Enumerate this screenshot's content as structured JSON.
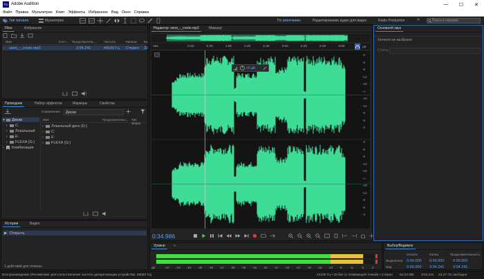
{
  "window": {
    "app_badge": "Au",
    "title": "Adobe Audition",
    "minimize": "—",
    "maximize": "☐",
    "close": "✕"
  },
  "menu": [
    "Файл",
    "Правка",
    "Мультитрек",
    "Клип",
    "Эффекты",
    "Избранное",
    "Вид",
    "Окно",
    "Справка"
  ],
  "toolbar": {
    "waveform_label": "Тип сигнала",
    "multitrack_label": "Мультитрек",
    "workspaces": [
      "По умолчанию",
      "Редактирование аудио для видео",
      "Radio Production"
    ],
    "more": "»",
    "search_placeholder": "Поиск в справке"
  },
  "files_panel": {
    "tabs": [
      "Files",
      "Избранное"
    ],
    "columns": [
      "Имя",
      "Сост...",
      "Продолжитель...",
      "Частота",
      "Каналы",
      "Би"
    ],
    "rows": [
      {
        "name": "sient_-_credo.mp3",
        "duration": "3:04.241",
        "rate": "44100 Гц",
        "channels": "Стерео",
        "bits": "32"
      }
    ]
  },
  "browser_panel": {
    "tabs": [
      "Проводник",
      "Набор эффектов",
      "Маркеры",
      "Свойства"
    ],
    "contents_label": "Содержание:",
    "contents_value": "Диски",
    "tree": [
      "Диски",
      "C:",
      "Локальный",
      "E:",
      "FLEXA (G:)",
      "Комбинации"
    ],
    "columns": [
      "Имя",
      "Продолжительн...",
      "Тип медиа"
    ],
    "rows": [
      "Локальный диск (D:)",
      "C:",
      "E:",
      "FLEXA (G:)"
    ]
  },
  "history_panel": {
    "tabs": [
      "История",
      "Видео"
    ],
    "items": [
      "Открыть"
    ],
    "status": "1 действий для отмены"
  },
  "editor": {
    "tabs": [
      "Редактор: sient_-_credo.mp3",
      "Микшер"
    ],
    "time_labels": [
      "чмс",
      "0:20",
      "0:40",
      "1:00",
      "1:20",
      "1:40",
      "2:00",
      "2:20",
      "2:40",
      "3:00"
    ],
    "time_values_sec": [
      0,
      20,
      40,
      60,
      80,
      100,
      120,
      140,
      160,
      180
    ],
    "total_sec": 184.2,
    "playhead_sec": 34.986,
    "db_labels_top": [
      "дБ",
      "-3",
      "-6",
      "-9",
      "-12",
      "-18",
      "-∞",
      "-18",
      "-12",
      "-9",
      "-6",
      "-3"
    ],
    "db_labels_bottom": [
      "дБ",
      "-3",
      "-6",
      "-9",
      "-12",
      "-18",
      "-∞",
      "-18",
      "-12",
      "-9",
      "-6",
      "-3"
    ],
    "hud_value": "+0 дБ",
    "current_time": "0:34.986",
    "wave_color": "#3fdc98"
  },
  "levels_panel": {
    "title": "Уровни",
    "scale_labels": [
      "дБ",
      "-57",
      "-54",
      "-51",
      "-48",
      "-45",
      "-42",
      "-39",
      "-36",
      "-33",
      "-30",
      "-27",
      "-24",
      "-21",
      "-18",
      "-15",
      "-12",
      "-9",
      "-6",
      "-3",
      "0"
    ],
    "left_level_db": -3,
    "right_level_db": -3
  },
  "essential_sound": {
    "title": "Основной звук",
    "status": "Ничего не выбрано",
    "preset_label": "Стиль:"
  },
  "selection_view": {
    "title": "Выбор/Видимое",
    "columns": [
      "Начало",
      "Конец",
      "Продолжительность"
    ],
    "rows": [
      {
        "label": "Выделение",
        "start": "0:00.000",
        "end": "0:00.000",
        "duration": "0:00.000"
      },
      {
        "label": "Вид",
        "start": "0:00.000",
        "end": "3:04.241",
        "duration": "3:04.241"
      }
    ]
  },
  "statusbar": {
    "left": "Воспроизведение (Ресемплинг для сопоставления частоте дискретизации устройства: 48000 Гц)",
    "right": [
      "44100 Гц • 32-бит (с плавающей точкой) • Стерео",
      "62,04 МБ",
      "3:04.241",
      "43,47 ГБ свободно"
    ]
  }
}
